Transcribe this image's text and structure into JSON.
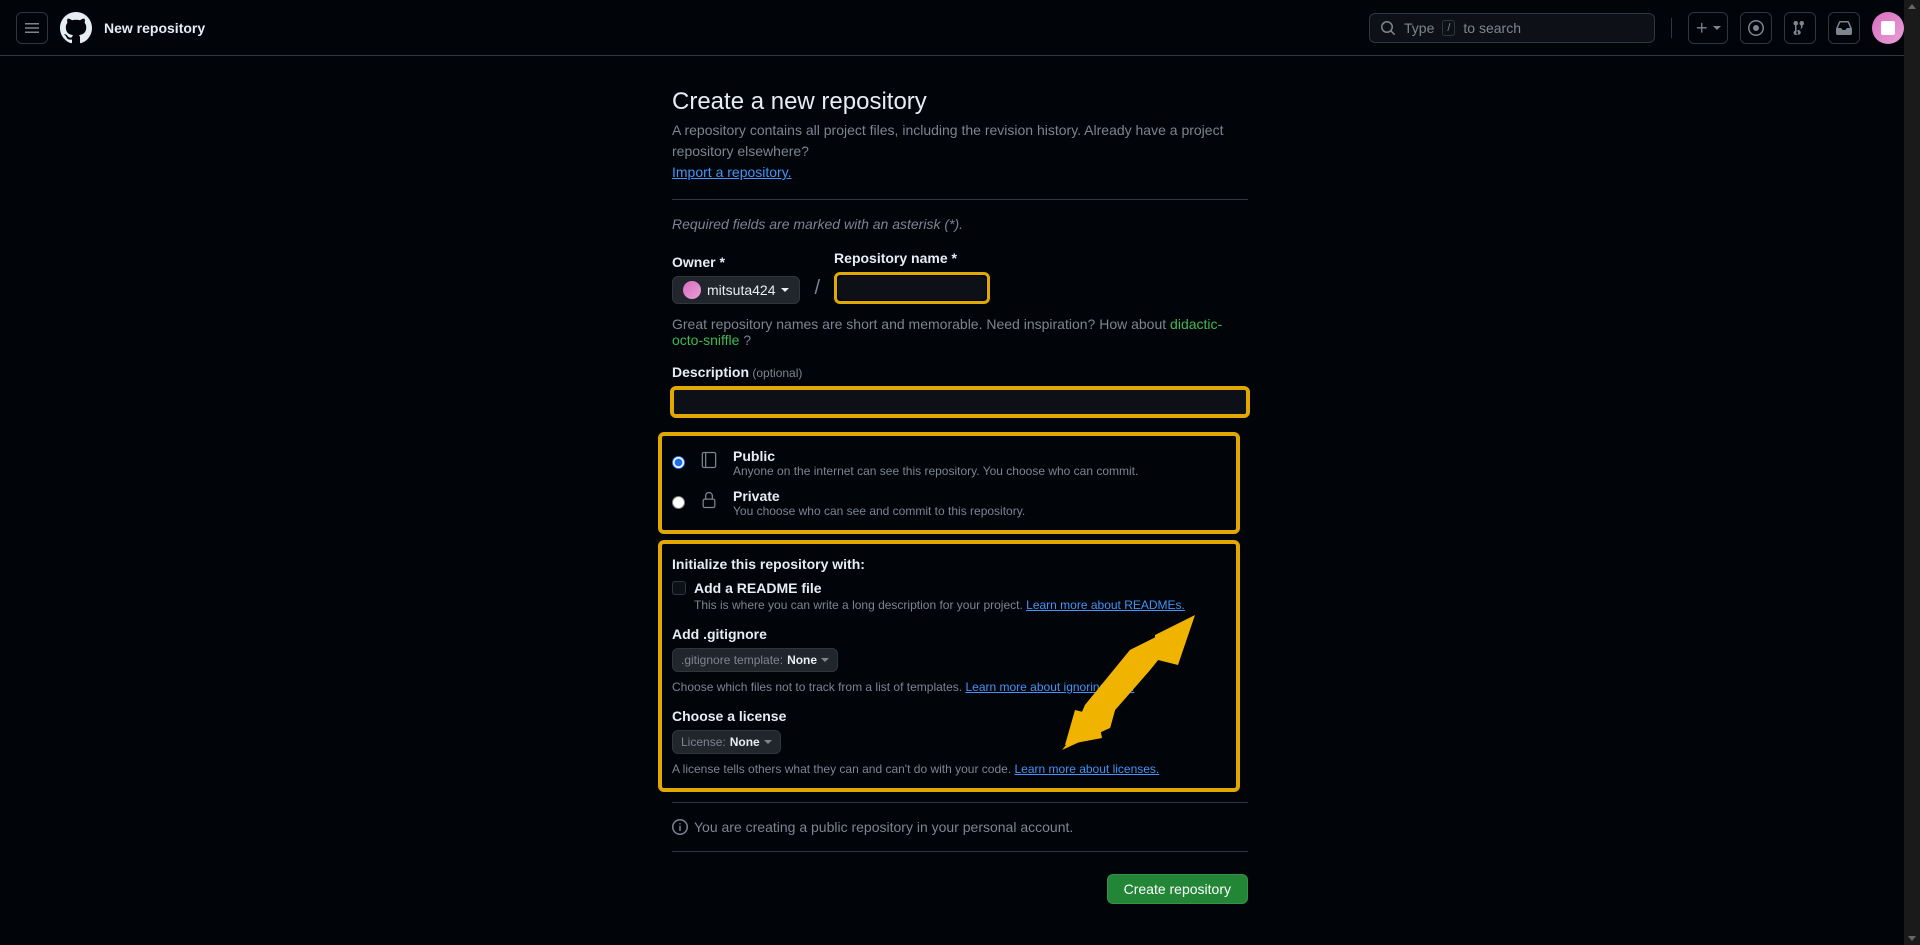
{
  "header": {
    "title": "New repository",
    "search_prefix": "Type ",
    "search_key": "/",
    "search_suffix": " to search"
  },
  "page": {
    "heading": "Create a new repository",
    "subtitle": "A repository contains all project files, including the revision history. Already have a project repository elsewhere? ",
    "import_link": "Import a repository.",
    "required_note": "Required fields are marked with an asterisk (*).",
    "owner_label": "Owner *",
    "owner_value": "mitsuta424",
    "repo_name_label": "Repository name *",
    "suggest_text": "Great repository names are short and memorable. Need inspiration? How about ",
    "suggest_name": "didactic-octo-sniffle",
    "suggest_q": " ?",
    "desc_label": "Description",
    "optional": " (optional)"
  },
  "visibility": {
    "public_title": "Public",
    "public_desc": "Anyone on the internet can see this repository. You choose who can commit.",
    "private_title": "Private",
    "private_desc": "You choose who can see and commit to this repository."
  },
  "init": {
    "heading": "Initialize this repository with:",
    "readme_label": "Add a README file",
    "readme_desc": "This is where you can write a long description for your project. ",
    "readme_link": "Learn more about READMEs.",
    "gitignore_heading": "Add .gitignore",
    "gitignore_prefix": ".gitignore template: ",
    "gitignore_value": "None",
    "gitignore_desc": "Choose which files not to track from a list of templates. ",
    "gitignore_link": "Learn more about ignoring files.",
    "license_heading": "Choose a license",
    "license_prefix": "License: ",
    "license_value": "None",
    "license_desc": "A license tells others what they can and can't do with your code. ",
    "license_link": "Learn more about licenses."
  },
  "info": "You are creating a public repository in your personal account.",
  "submit": "Create repository"
}
